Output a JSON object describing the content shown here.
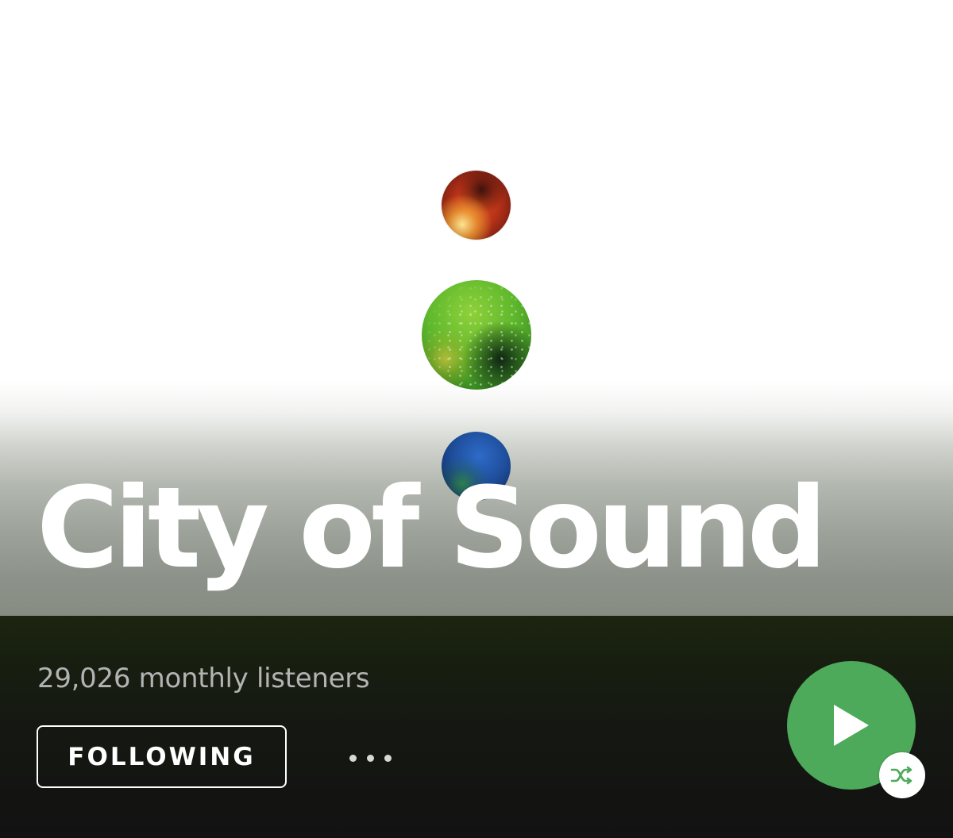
{
  "artist": {
    "name": "City of Sound",
    "monthly_listeners": "29,026 monthly listeners"
  },
  "header_art": {
    "orbs": [
      "red-orb",
      "green-orb",
      "blue-orb"
    ]
  },
  "actions": {
    "follow_label": "FOLLOWING",
    "more_icon": "more-options-icon",
    "play_icon": "play-icon",
    "shuffle_icon": "shuffle-icon"
  },
  "colors": {
    "accent": "#4daa5a",
    "shuffle_icon": "#4daa5a",
    "title_text": "#ffffff",
    "secondary_text": "#b3b3b3",
    "background": "#121212"
  }
}
